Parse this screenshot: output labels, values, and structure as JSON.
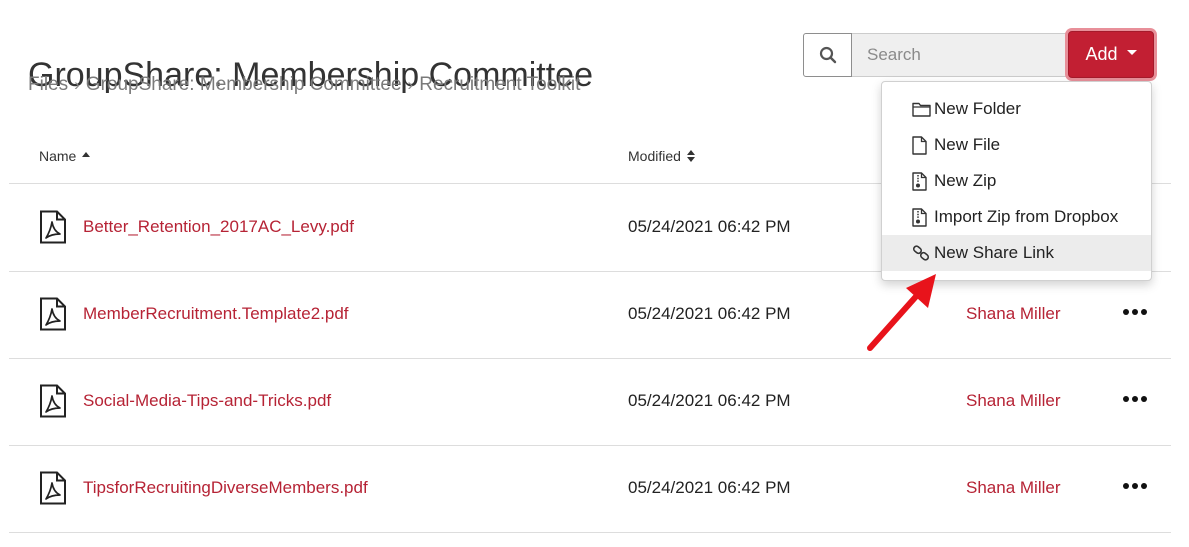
{
  "header": {
    "title": "GroupShare: Membership Committee",
    "breadcrumb": [
      "Files",
      "GroupShare: Membership Committee",
      "Recruitment Toolkit"
    ]
  },
  "search": {
    "placeholder": "Search",
    "icon": "search-icon"
  },
  "add_button": {
    "label": "Add",
    "color": "#c21f33"
  },
  "table": {
    "columns": {
      "name": "Name",
      "modified": "Modified"
    },
    "rows": [
      {
        "name": "Better_Retention_2017AC_Levy.pdf",
        "modified": "05/24/2021 06:42 PM",
        "owner": "",
        "icon": "pdf-file-icon"
      },
      {
        "name": "MemberRecruitment.Template2.pdf",
        "modified": "05/24/2021 06:42 PM",
        "owner": "Shana Miller",
        "icon": "pdf-file-icon"
      },
      {
        "name": "Social-Media-Tips-and-Tricks.pdf",
        "modified": "05/24/2021 06:42 PM",
        "owner": "Shana Miller",
        "icon": "pdf-file-icon"
      },
      {
        "name": "TipsforRecruitingDiverseMembers.pdf",
        "modified": "05/24/2021 06:42 PM",
        "owner": "Shana Miller",
        "icon": "pdf-file-icon"
      }
    ]
  },
  "add_menu": {
    "items": [
      {
        "label": "New Folder",
        "icon": "folder-icon"
      },
      {
        "label": "New File",
        "icon": "file-icon"
      },
      {
        "label": "New Zip",
        "icon": "zip-file-icon"
      },
      {
        "label": "Import Zip from Dropbox",
        "icon": "zip-file-icon"
      },
      {
        "label": "New Share Link",
        "icon": "link-icon",
        "highlighted": true
      }
    ]
  },
  "colors": {
    "link_red": "#b62335",
    "annotation_arrow": "#e8131b"
  }
}
